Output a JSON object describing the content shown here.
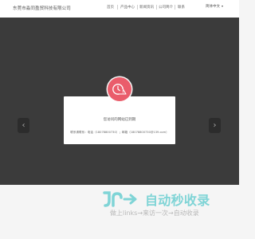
{
  "header": {
    "company_name": "东莞市淼同盈贸科技有限公司",
    "nav": [
      "首页",
      "产品中心",
      "新闻资讯",
      "公司简介",
      "联系"
    ],
    "language": "简体中文"
  },
  "banner": {
    "prev_icon": "chevron-left-icon",
    "next_icon": "chevron-right-icon",
    "background_color": "#3b3b3b"
  },
  "dialog": {
    "icon": "warning-clock-icon",
    "icon_color": "#ea5d6b",
    "message": "您访问的网站已到期",
    "contact": "联系请联系：电话（18078800730）；邮箱（18078800730@139.com）"
  },
  "watermark": {
    "title": "自动秒收录",
    "subtitle": "做上links→来访一次→自动收录"
  }
}
